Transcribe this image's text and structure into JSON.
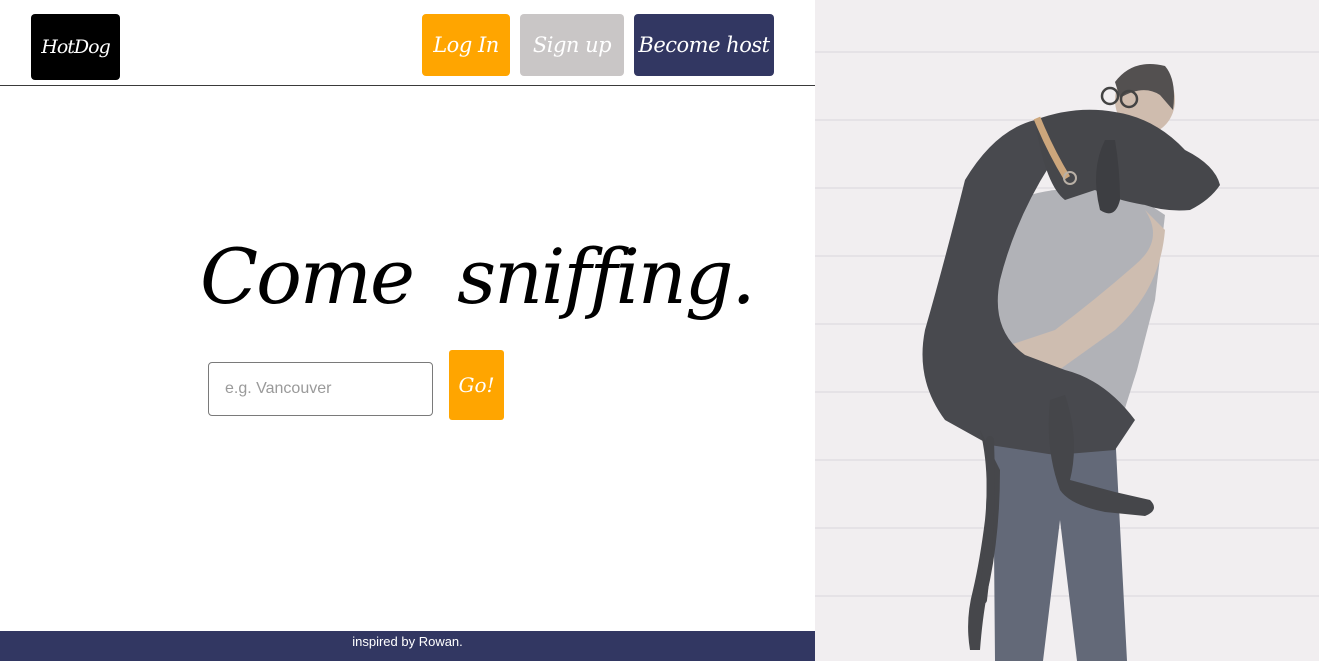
{
  "brand": {
    "logo_text": "HotDog"
  },
  "nav": {
    "login_label": "Log In",
    "signup_label": "Sign up",
    "host_label": "Become host"
  },
  "hero": {
    "headline": "Come sniffing.",
    "search_placeholder": "e.g. Vancouver",
    "search_value": "",
    "go_label": "Go!"
  },
  "footer": {
    "text": "inspired by Rowan."
  },
  "image": {
    "description_icon": "man-carrying-dog-photo"
  },
  "colors": {
    "accent_orange": "#ffa500",
    "navy": "#323762",
    "grey_button": "#c9c6c6",
    "logo_bg": "#000000"
  }
}
